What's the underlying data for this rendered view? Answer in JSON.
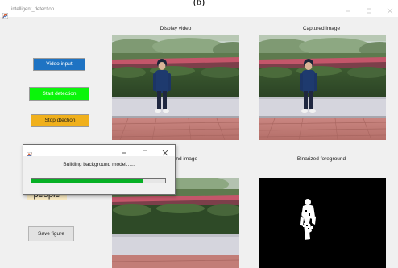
{
  "figure_label": "(b)",
  "window": {
    "title": "intelligent_detection"
  },
  "axes": {
    "display_title": "Display video",
    "captured_title": "Captured image",
    "background_title": "Background image",
    "binarized_title": "Binarized foreground"
  },
  "buttons": {
    "video_input": "Video input",
    "start_detection": "Start detection",
    "stop_detection": "Stop dtection",
    "save_figure": "Save figure"
  },
  "status_label": "people",
  "progress_dialog": {
    "message": "Building background model......",
    "progress": 0.83
  },
  "icons": {
    "app": "matlab-figure-icon",
    "minimize": "minimize-icon",
    "maximize": "maximize-icon",
    "close": "close-icon"
  },
  "colors": {
    "video_input_button": "#1e73c3",
    "start_detection_button": "#0af50a",
    "stop_detection_button": "#f0b01c",
    "progress_fill": "#06b025",
    "status_label_background": "#fbecc4"
  }
}
